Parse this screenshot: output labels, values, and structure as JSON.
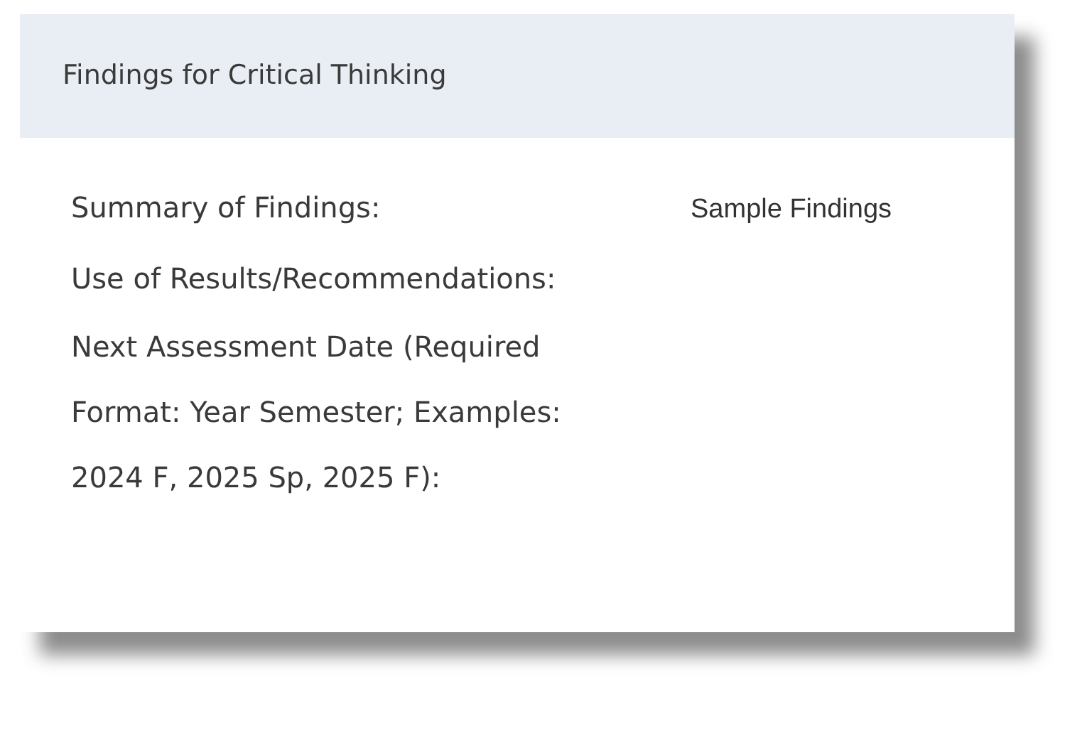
{
  "card": {
    "title": "Findings for Critical Thinking",
    "fields": [
      {
        "label": "Summary of Findings:",
        "value": "Sample Findings"
      },
      {
        "label": "Use of Results/Recommendations:"
      },
      {
        "label": "Next Assessment Date (Required Format: Year Semester; Examples: 2024 F, 2025 Sp, 2025 F):"
      }
    ]
  }
}
